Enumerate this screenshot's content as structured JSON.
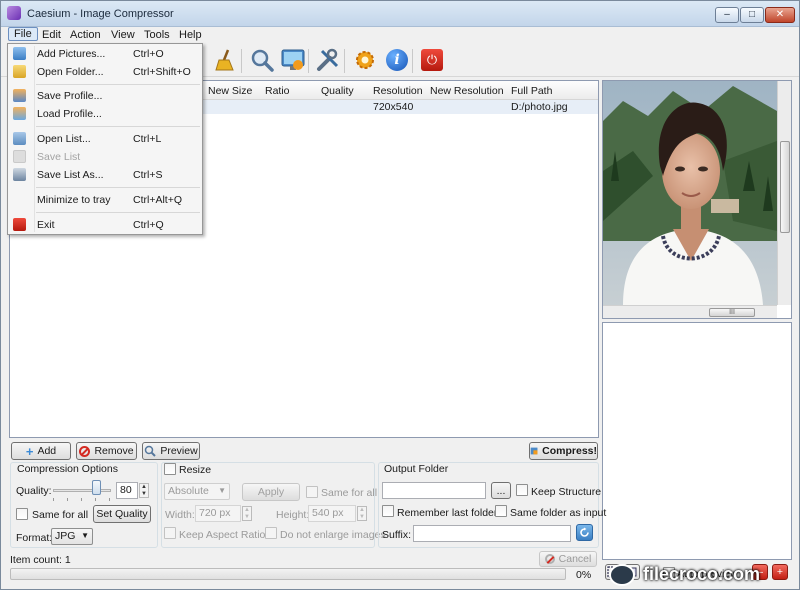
{
  "window": {
    "title": "Caesium - Image Compressor",
    "minimize": "–",
    "maximize": "□",
    "close": "✕"
  },
  "menubar": [
    "File",
    "Edit",
    "Action",
    "View",
    "Tools",
    "Help"
  ],
  "file_menu": [
    {
      "label": "Add Pictures...",
      "shortcut": "Ctrl+O",
      "icon": "add-pictures-icon",
      "enabled": true
    },
    {
      "label": "Open Folder...",
      "shortcut": "Ctrl+Shift+O",
      "icon": "folder-icon",
      "enabled": true
    },
    {
      "label": "Save Profile...",
      "shortcut": "",
      "icon": "save-profile-icon",
      "enabled": true
    },
    {
      "label": "Load Profile...",
      "shortcut": "",
      "icon": "load-profile-icon",
      "enabled": true
    },
    {
      "label": "Open List...",
      "shortcut": "Ctrl+L",
      "icon": "open-list-icon",
      "enabled": true
    },
    {
      "label": "Save List",
      "shortcut": "",
      "icon": "save-list-icon",
      "enabled": false
    },
    {
      "label": "Save List As...",
      "shortcut": "Ctrl+S",
      "icon": "save-list-as-icon",
      "enabled": true
    },
    {
      "label": "Minimize to tray",
      "shortcut": "Ctrl+Alt+Q",
      "icon": "",
      "enabled": true
    },
    {
      "label": "Exit",
      "shortcut": "Ctrl+Q",
      "icon": "exit-icon",
      "enabled": true
    }
  ],
  "toolbar": {
    "icons": [
      "clear-icon",
      "search-icon",
      "display-icon",
      "tools-icon",
      "settings-icon",
      "info-icon",
      "quit-icon"
    ]
  },
  "list": {
    "columns": [
      "New Size",
      "Ratio",
      "Quality",
      "Resolution",
      "New Resolution",
      "Full Path"
    ],
    "rows": [
      {
        "resolution": "720x540",
        "full_path": "D:/photo.jpg"
      }
    ]
  },
  "preview": {
    "hscroll_glyph": "III"
  },
  "buttons": {
    "add": "Add",
    "remove": "Remove",
    "preview": "Preview",
    "compress": "Compress!"
  },
  "compression": {
    "title": "Compression Options",
    "quality_label": "Quality:",
    "quality_value": "80",
    "same_for_all": "Same for all",
    "set_quality": "Set Quality",
    "format_label": "Format:",
    "format_value": "JPG"
  },
  "resize": {
    "title": "Resize",
    "mode": "Absolute",
    "apply": "Apply",
    "same_for_all": "Same for all",
    "width_label": "Width:",
    "width_value": "720 px",
    "height_label": "Height:",
    "height_value": "540 px",
    "keep_aspect": "Keep Aspect Ratio",
    "no_enlarge": "Do not enlarge images"
  },
  "output": {
    "title": "Output Folder",
    "browse": "...",
    "keep_structure": "Keep Structure",
    "remember_last": "Remember last folder",
    "same_as_input": "Same folder as input",
    "suffix_label": "Suffix:",
    "folder_value": "",
    "suffix_value": ""
  },
  "status": {
    "item_count": "Item count: 1",
    "cancel": "Cancel",
    "progress": "0%",
    "progress_value": 0,
    "auto_preview": "Auto preview"
  },
  "watermark": "filecroco.com",
  "colors": {
    "accent": "#3a8ad6",
    "danger": "#d42a22",
    "selection": "#e7eef7"
  }
}
